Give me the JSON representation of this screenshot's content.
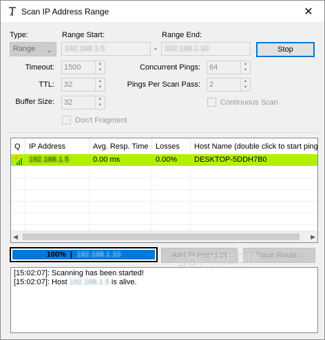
{
  "window": {
    "title": "Scan IP Address Range",
    "close_glyph": "✕",
    "icon": "antenna-icon"
  },
  "form": {
    "type_label": "Type:",
    "type_value": "Range",
    "range_start_label": "Range Start:",
    "range_start_value": "192.168.1.5",
    "range_separator": "-",
    "range_end_label": "Range End:",
    "range_end_value": "192.168.1.10",
    "stop_label": "Stop",
    "timeout_label": "Timeout:",
    "timeout_value": "1500",
    "ttl_label": "TTL:",
    "ttl_value": "32",
    "buffer_label": "Buffer Size:",
    "buffer_value": "32",
    "dont_fragment_label": "Don't Fragment",
    "concurrent_label": "Concurrent Pings:",
    "concurrent_value": "64",
    "pings_per_pass_label": "Pings Per Scan Pass:",
    "pings_per_pass_value": "2",
    "continuous_label": "Continuous Scan"
  },
  "table": {
    "columns": [
      "Q",
      "IP Address",
      "Avg. Resp. Time",
      "Losses",
      "Host Name (double click to start ping)"
    ],
    "rows": [
      {
        "ip": "192.168.1.5",
        "resp": "0.00 ms",
        "losses": "0.00%",
        "host": "DESKTOP-5DDH7B0",
        "status": "alive"
      }
    ]
  },
  "progress": {
    "percent": 100,
    "label": "100%",
    "current_ip": "192.168.1.10"
  },
  "actions": {
    "add_label": "Add To Host List",
    "trace_label": "Trace Route..."
  },
  "log": [
    {
      "text": "[15:02:07]: Scanning has been started!"
    },
    {
      "prefix": "[15:02:07]: Host ",
      "ip": "192.168.1.5",
      "suffix": " is alive."
    }
  ],
  "watermark": "SOFTPEDIA",
  "colors": {
    "alive_row": "#b3f000",
    "progress": "#0078d7",
    "accent": "#0078d7"
  }
}
